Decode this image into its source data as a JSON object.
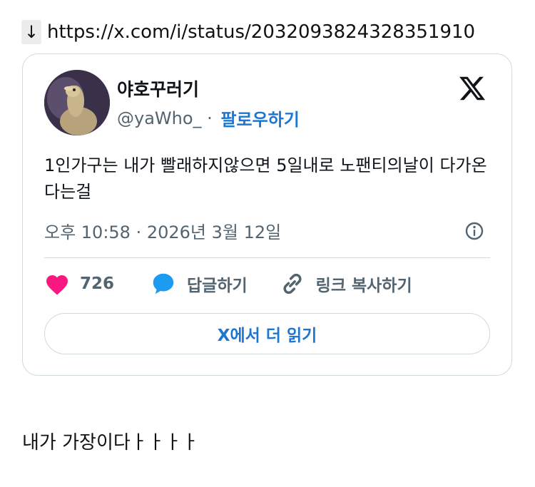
{
  "link": {
    "arrow": "↓",
    "url": "https://x.com/i/status/2032093824328351910"
  },
  "tweet": {
    "author_name": "야호꾸러기",
    "handle": "@yaWho_",
    "separator": " · ",
    "follow_label": "팔로우하기",
    "text": "1인가구는 내가 빨래하지않으면 5일내로 노팬티의날이 다가온다는걸",
    "timestamp": "오후 10:58 · 2026년 3월 12일",
    "likes_count": "726",
    "reply_label": "답글하기",
    "copy_link_label": "링크 복사하기",
    "read_more_label": "X에서 더 읽기"
  },
  "caption": "내가 가장이다ㅏㅏㅏㅏ",
  "colors": {
    "accent": "#1d77d2",
    "like": "#f91880",
    "reply": "#1d9bf0",
    "muted": "#536471",
    "border": "#cfd9de"
  },
  "icons": [
    "down-arrow-icon",
    "x-logo-icon",
    "info-icon",
    "heart-icon",
    "reply-bubble-icon",
    "link-icon"
  ]
}
